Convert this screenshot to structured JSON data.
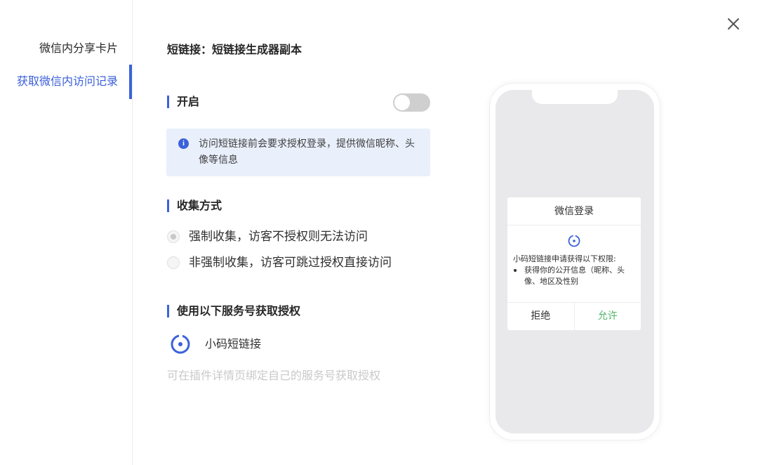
{
  "sidebar": {
    "items": [
      {
        "label": "微信内分享卡片",
        "active": false
      },
      {
        "label": "获取微信内访问记录",
        "active": true
      }
    ]
  },
  "header": {
    "title": "短链接：短链接生成器副本"
  },
  "section_enable": {
    "title": "开启",
    "toggle_on": false
  },
  "info": {
    "text": "访问短链接前会要求授权登录，提供微信昵称、头像等信息"
  },
  "section_collect": {
    "title": "收集方式",
    "options": [
      {
        "label": "强制收集，访客不授权则无法访问",
        "checked": true
      },
      {
        "label": "非强制收集，访客可跳过授权直接访问",
        "checked": false
      }
    ]
  },
  "section_service": {
    "title": "使用以下服务号获取授权",
    "service_name": "小码短链接",
    "hint": "可在插件详情页绑定自己的服务号获取授权"
  },
  "preview": {
    "dialog_title": "微信登录",
    "request_text": "小码短链接申请获得以下权限:",
    "permission_item": "获得你的公开信息（昵称、头像、地区及性别",
    "reject_label": "拒绝",
    "allow_label": "允许"
  },
  "colors": {
    "accent": "#3b62db",
    "allow_green": "#52b36c",
    "info_bg": "#e9effb"
  }
}
